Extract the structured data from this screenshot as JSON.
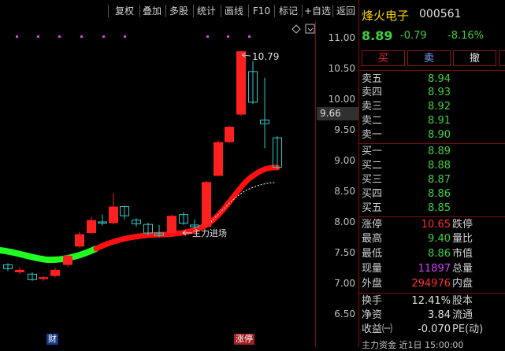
{
  "toolbar": {
    "items": [
      {
        "label": "复权"
      },
      {
        "label": "叠加"
      },
      {
        "label": "多股"
      },
      {
        "label": "统计"
      },
      {
        "label": "画线"
      },
      {
        "label": "F10"
      },
      {
        "label": "标记"
      },
      {
        "label": "+自选"
      },
      {
        "label": "返回"
      }
    ]
  },
  "axis": {
    "ticks": [
      "11.00",
      "10.50",
      "10.00",
      "9.50",
      "9.00",
      "8.50",
      "8.00",
      "7.50",
      "7.00",
      "6.50"
    ],
    "current_marker": "9.66"
  },
  "chart": {
    "high_label": "10.79",
    "annotation": "主力进场",
    "bottom_badge_left": "财",
    "bottom_badge_right": "涨停",
    "colors": {
      "up": "#ff2020",
      "down": "#30c8c8",
      "ma_green": "#20ff20",
      "ma_red": "#ff1010"
    }
  },
  "quote": {
    "name": "烽火电子",
    "code": "000561",
    "price": "8.89",
    "change": "-0.79",
    "change_pct": "-8.16%",
    "buttons": {
      "buy": "买",
      "sell": "卖",
      "cancel": "撤"
    },
    "asks": [
      {
        "label": "卖五",
        "price": "8.94"
      },
      {
        "label": "卖四",
        "price": "8.93"
      },
      {
        "label": "卖三",
        "price": "8.92"
      },
      {
        "label": "卖二",
        "price": "8.91"
      },
      {
        "label": "卖一",
        "price": "8.90"
      }
    ],
    "bids": [
      {
        "label": "买一",
        "price": "8.89"
      },
      {
        "label": "买二",
        "price": "8.88"
      },
      {
        "label": "买三",
        "price": "8.87"
      },
      {
        "label": "买四",
        "price": "8.86"
      },
      {
        "label": "买五",
        "price": "8.85"
      }
    ],
    "stats": [
      {
        "label": "涨停",
        "value": "10.65",
        "label2": "跌停"
      },
      {
        "label": "最高",
        "value": "9.40",
        "label2": "量比"
      },
      {
        "label": "最低",
        "value": "8.86",
        "label2": "市值"
      },
      {
        "label": "现量",
        "value": "11897",
        "label2": "总量"
      },
      {
        "label": "外盘",
        "value": "294976",
        "label2": "内盘"
      }
    ],
    "stats2": [
      {
        "label": "换手",
        "value": "12.41%",
        "label2": "股本"
      },
      {
        "label": "净资",
        "value": "3.84",
        "label2": "流通"
      },
      {
        "label": "收益㈠",
        "value": "-0.070",
        "label2": "PE(动)"
      }
    ],
    "bottom_text": "主力资金 近1日 15:00:00"
  }
}
